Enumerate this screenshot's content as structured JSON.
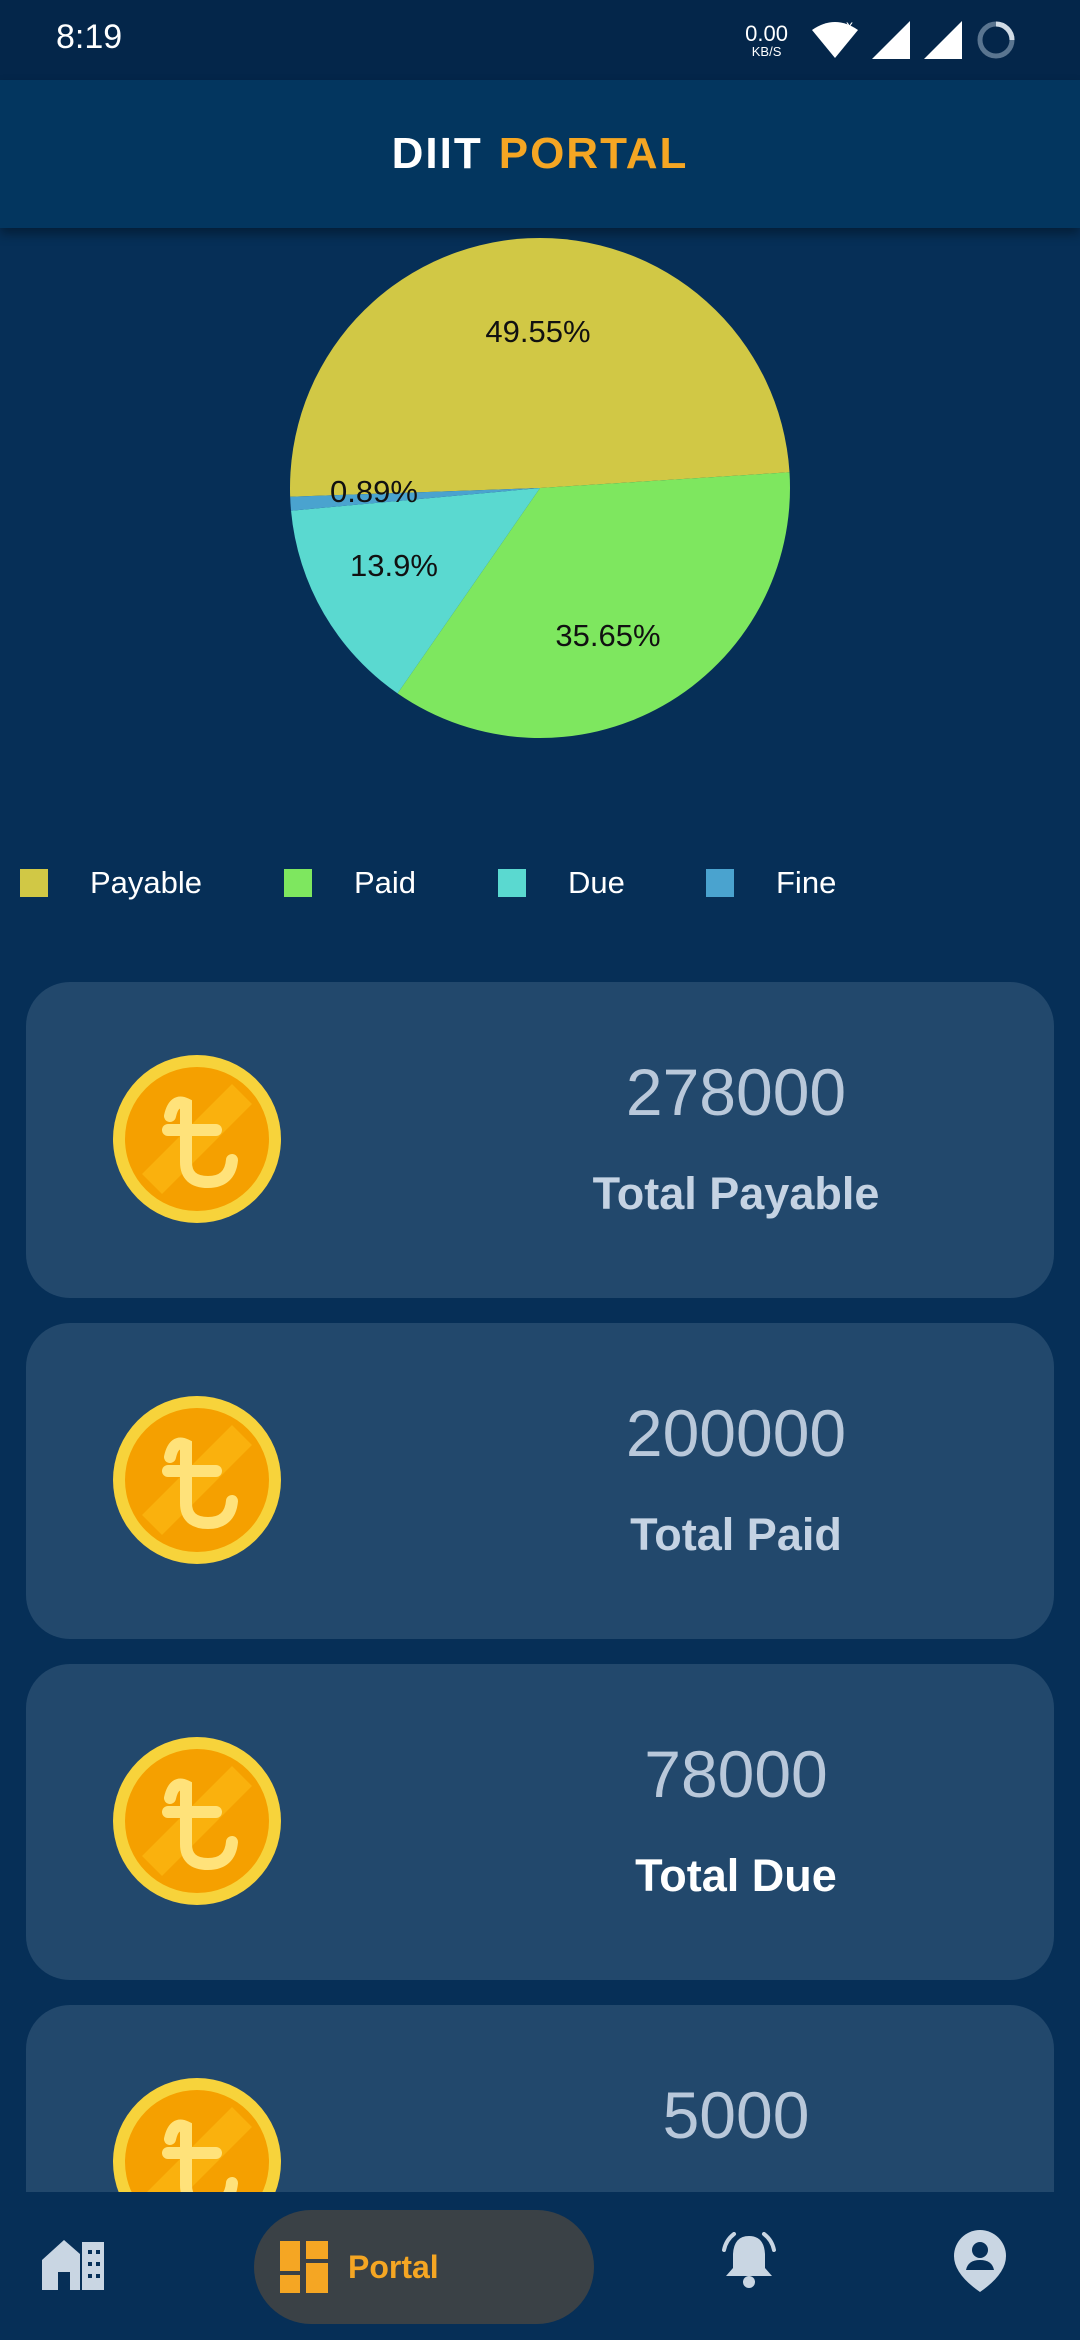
{
  "status_bar": {
    "time": "8:19",
    "net_speed_value": "0.00",
    "net_speed_unit": "KB/S",
    "icons": [
      "wifi-icon",
      "signal-icon",
      "signal-icon",
      "loading-icon"
    ]
  },
  "header": {
    "logo_part1": "DIIT",
    "logo_part2": "PORTAL"
  },
  "colors": {
    "background": "#062f57",
    "header": "#03365f",
    "card": "#22486c",
    "accent": "#f5a623"
  },
  "chart_data": {
    "type": "pie",
    "slices": [
      {
        "label": "Payable",
        "value": 49.55,
        "display": "49.55%",
        "color": "#d1c845"
      },
      {
        "label": "Paid",
        "value": 35.65,
        "display": "35.65%",
        "color": "#7ee75f"
      },
      {
        "label": "Due",
        "value": 13.9,
        "display": "13.9%",
        "color": "#5ad9d0"
      },
      {
        "label": "Fine",
        "value": 0.89,
        "display": "0.89%",
        "color": "#4aa3cf"
      }
    ],
    "legend_placement": "bottom"
  },
  "legend": {
    "items": [
      "Payable",
      "Paid",
      "Due",
      "Fine"
    ]
  },
  "cards": [
    {
      "value": "278000",
      "label": "Total Payable",
      "icon": "taka-coin-icon"
    },
    {
      "value": "200000",
      "label": "Total Paid",
      "icon": "taka-coin-icon"
    },
    {
      "value": "78000",
      "label": "Total Due",
      "icon": "taka-coin-icon"
    },
    {
      "value": "5000",
      "label": "",
      "icon": "taka-coin-icon"
    }
  ],
  "bottom_nav": {
    "items": [
      "home-icon",
      "portal-icon",
      "notification-bell-icon",
      "profile-icon"
    ],
    "portal_label": "Portal",
    "active": "Portal"
  }
}
